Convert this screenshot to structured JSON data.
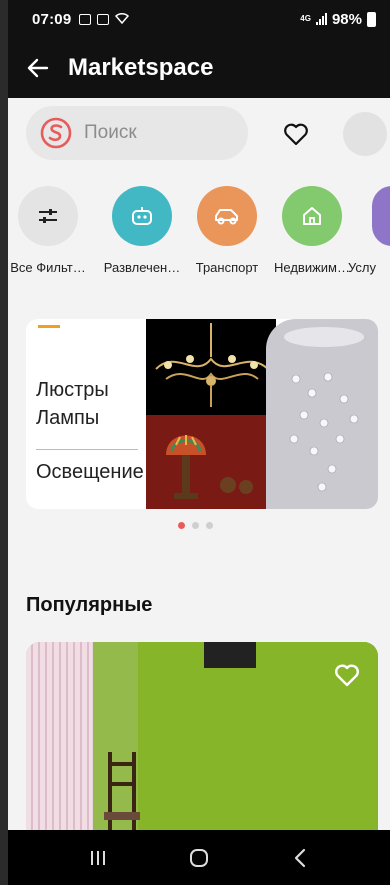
{
  "status_bar": {
    "time": "07:09",
    "network": "4G",
    "battery": "98%"
  },
  "app_bar": {
    "title": "Marketspace",
    "back_icon": "arrow-left-icon"
  },
  "search": {
    "placeholder": "Поиск",
    "logo_color": "#e85b5b"
  },
  "categories": [
    {
      "label": "Все Фильт…",
      "icon": "sliders-icon",
      "color": "#e4e4e4"
    },
    {
      "label": "Развлечен…",
      "icon": "robot-icon",
      "color": "#41b8c4"
    },
    {
      "label": "Транспорт",
      "icon": "car-icon",
      "color": "#ea955a"
    },
    {
      "label": "Недвижим…",
      "icon": "house-icon",
      "color": "#83c96e"
    },
    {
      "label": "Услу",
      "icon": "service-icon",
      "color": "#8e75c8"
    }
  ],
  "banner": {
    "line1": "Люстры",
    "line2": "Лампы",
    "line3": "Освещение",
    "accent_color": "#f0a020"
  },
  "carousel": {
    "count": 3,
    "active": 0,
    "active_color": "#e85b5b"
  },
  "popular": {
    "title": "Популярные"
  },
  "nav": [
    "recent-apps-icon",
    "home-icon",
    "back-icon"
  ]
}
